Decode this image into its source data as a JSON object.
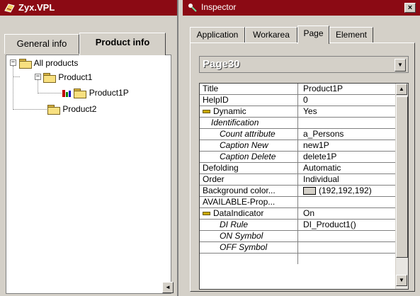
{
  "left_window": {
    "title": "Zyx.VPL",
    "tabs": [
      {
        "label": "General info"
      },
      {
        "label": "Product info"
      }
    ],
    "tree": [
      {
        "label": "All products"
      },
      {
        "label": "Product1"
      },
      {
        "label": "Product1P"
      },
      {
        "label": "Product2"
      }
    ],
    "scroll_left": "◄"
  },
  "inspector": {
    "title": "Inspector",
    "close": "×",
    "tabs": [
      {
        "label": "Application"
      },
      {
        "label": "Workarea"
      },
      {
        "label": "Page"
      },
      {
        "label": "Element"
      }
    ],
    "selected_tab": "Page",
    "page_select": "Page30",
    "dropdown_arrow": "▼",
    "scroll_up": "▲",
    "scroll_down": "▼",
    "properties": [
      {
        "name": "Title",
        "value": "Product1P"
      },
      {
        "name": "HelpID",
        "value": "0"
      },
      {
        "name": "Dynamic",
        "value": "Yes"
      },
      {
        "name": "Identification",
        "value": ""
      },
      {
        "name": "Count attribute",
        "value": "a_Persons"
      },
      {
        "name": "Caption New",
        "value": "new1P"
      },
      {
        "name": "Caption Delete",
        "value": "delete1P"
      },
      {
        "name": "Defolding",
        "value": "Automatic"
      },
      {
        "name": "Order",
        "value": "Individual"
      },
      {
        "name": "Background color...",
        "value": "(192,192,192)"
      },
      {
        "name": "AVAILABLE-Prop...",
        "value": ""
      },
      {
        "name": "DataIndicator",
        "value": "On"
      },
      {
        "name": "DI Rule",
        "value": "DI_Product1()"
      },
      {
        "name": "ON Symbol",
        "value": ""
      },
      {
        "name": "OFF Symbol",
        "value": ""
      }
    ]
  },
  "colors": {
    "titlebar": "#8b0a14",
    "face": "#d4d0c8"
  }
}
